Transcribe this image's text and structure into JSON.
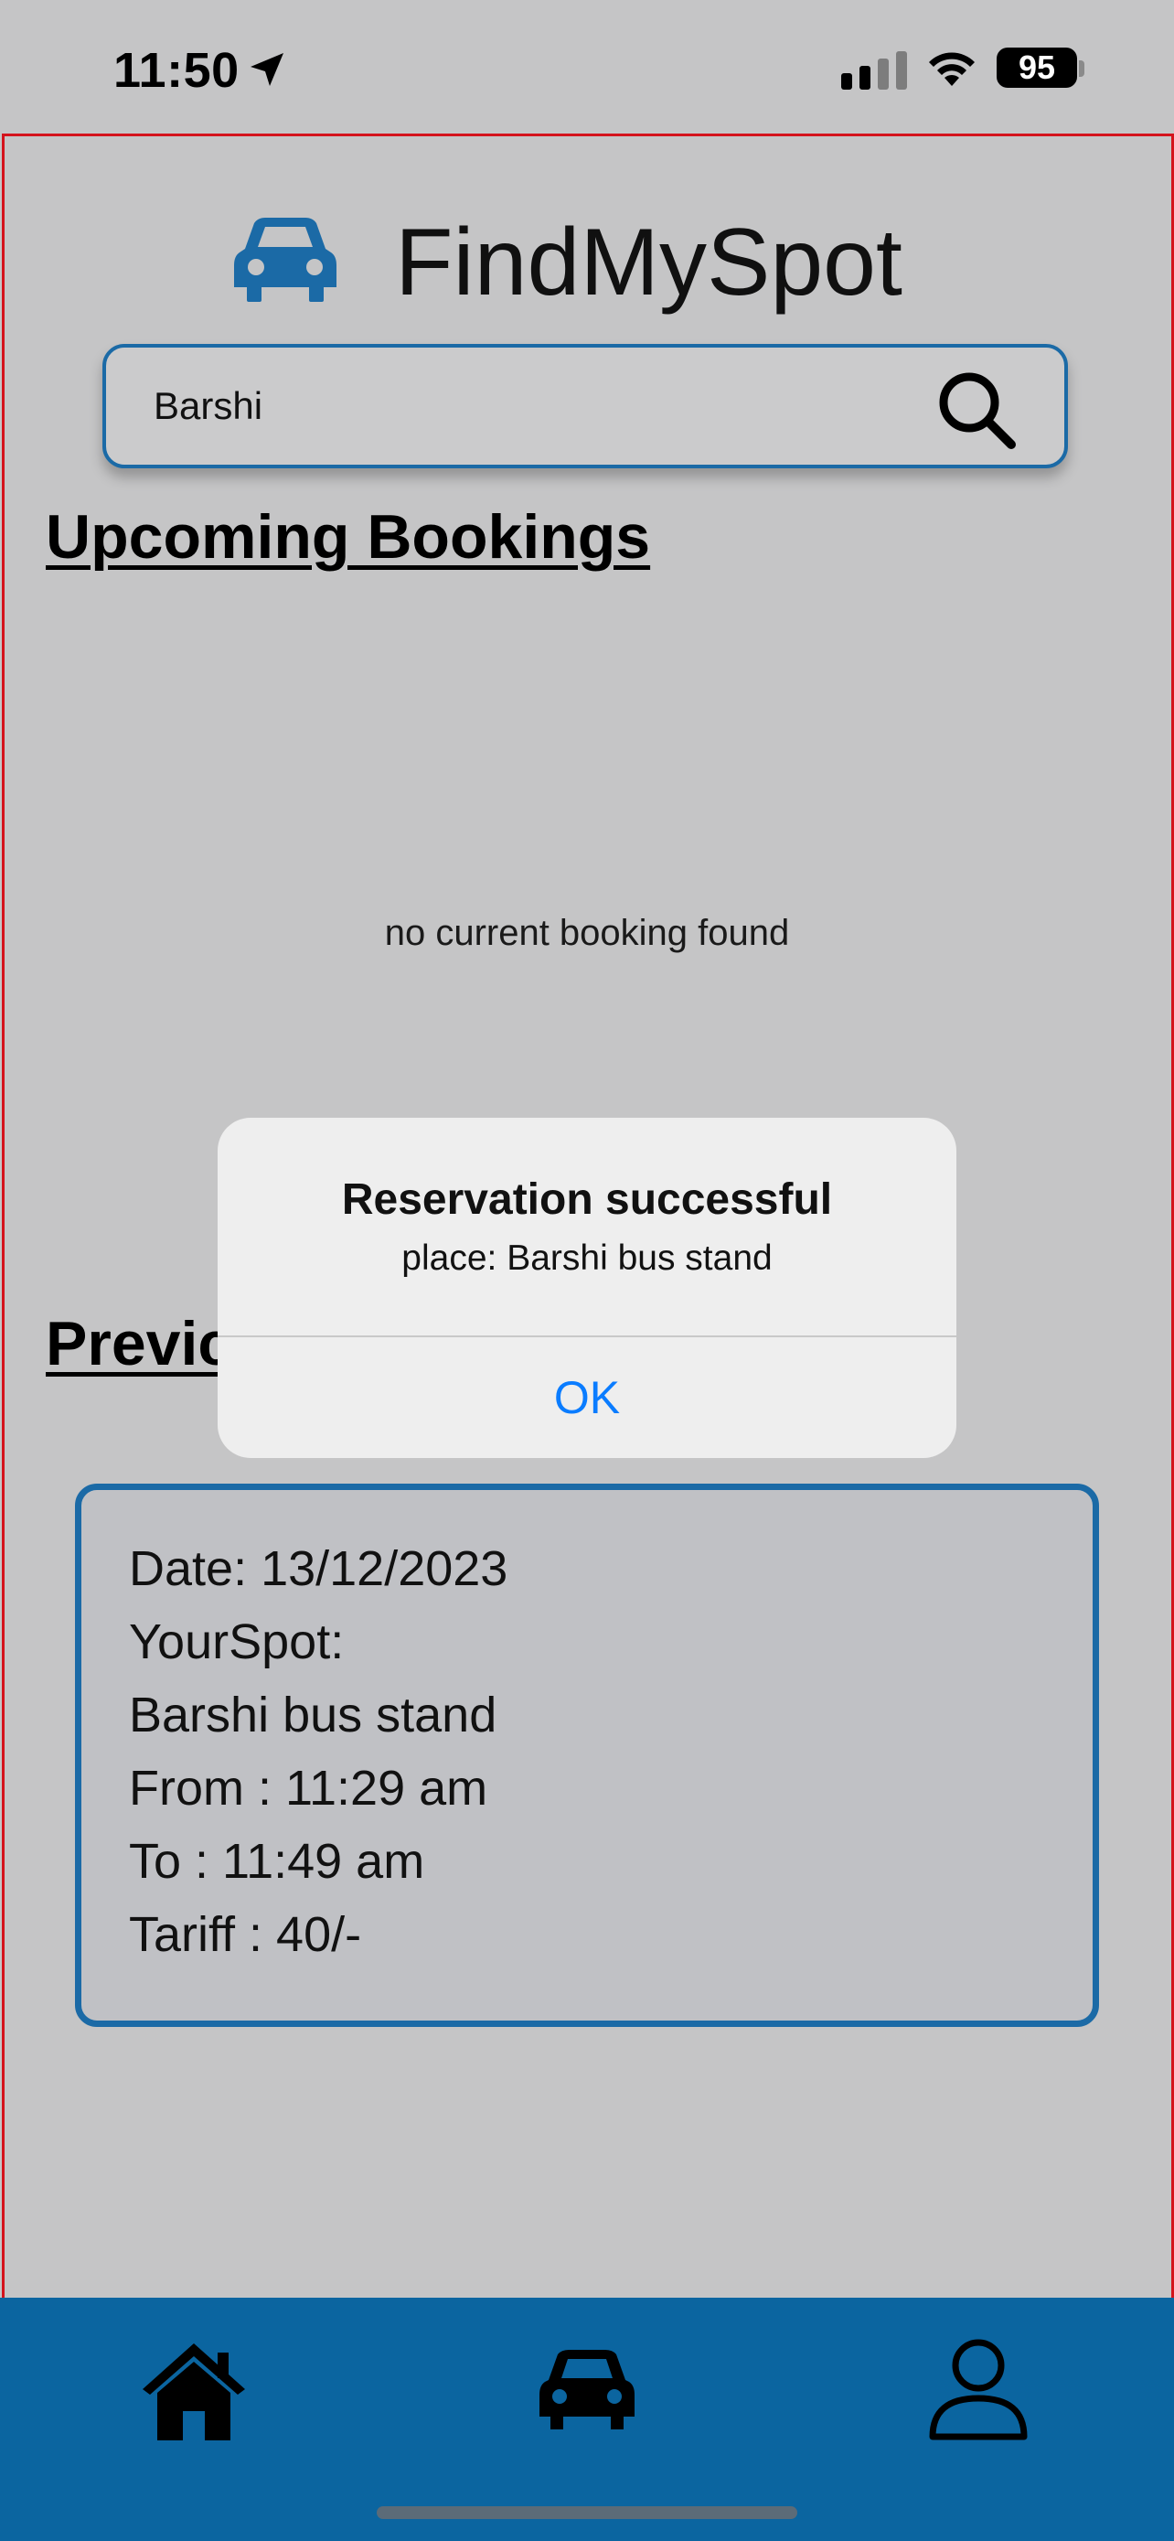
{
  "status_bar": {
    "time": "11:50",
    "battery": "95"
  },
  "header": {
    "app_title": "FindMySpot",
    "logo_icon": "car-icon"
  },
  "search": {
    "value": "Barshi",
    "icon": "search-icon"
  },
  "upcoming": {
    "title": "Upcoming Bookings",
    "empty_message": "no current booking found"
  },
  "previous": {
    "title": "Previous Bookings",
    "visible_title": "Previc",
    "booking": {
      "date": "Date: 13/12/2023",
      "spot_label": "YourSpot:",
      "spot": "Barshi bus stand",
      "from": "From : 11:29 am",
      "to": "To : 11:49 am",
      "tariff": "Tariff : 40/-"
    }
  },
  "alert": {
    "title": "Reservation successful",
    "message": "place: Barshi bus stand",
    "ok_label": "OK"
  },
  "tabbar": {
    "items": [
      "home-icon",
      "car-icon",
      "profile-icon"
    ]
  },
  "colors": {
    "accent": "#0b65a0",
    "frame": "#d4131c",
    "link": "#0a7cff",
    "background": "#c5c5c6"
  }
}
